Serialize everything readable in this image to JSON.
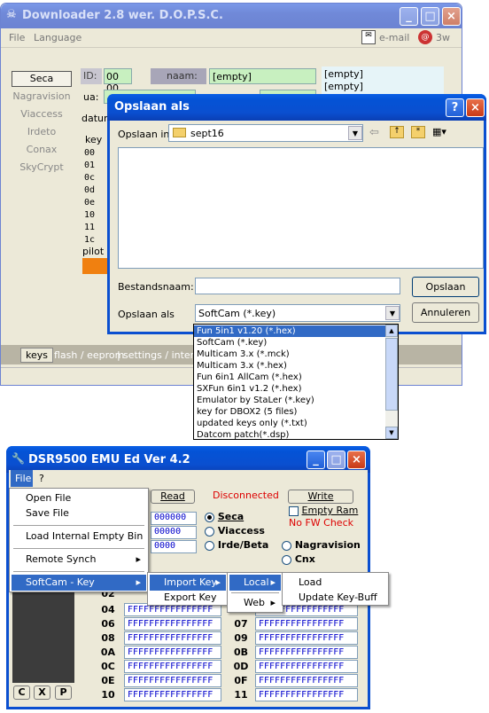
{
  "downloader": {
    "title": "Downloader 2.8 wer. D.O.P.S.C.",
    "menu": [
      "File",
      "Language"
    ],
    "email": "e-mail",
    "w3": "3w",
    "systems": [
      "Seca",
      "Nagravision",
      "Viaccess",
      "Irdeto",
      "Conax",
      "SkyCrypt"
    ],
    "id_label": "ID:",
    "id_value": "00 00",
    "naam_label": "naam:",
    "naam_value": "[empty]",
    "empty1": "[empty]",
    "empty2": "[empty]",
    "ua_label": "ua:",
    "datum_label": "datum",
    "key_label": "key",
    "keys": [
      "00",
      "01",
      "0c",
      "0d",
      "0e",
      "10",
      "11",
      "1c"
    ],
    "pilot_label": "pilot",
    "tabs": [
      "keys",
      "flash / eeprom",
      "settings / interne"
    ]
  },
  "save_dialog": {
    "title": "Opslaan als",
    "save_in_label": "Opslaan in:",
    "folder": "sept16",
    "filename_label": "Bestandsnaam:",
    "filename_value": "",
    "saveas_label": "Opslaan als",
    "type_value": "SoftCam (*.key)",
    "save_button": "Opslaan",
    "cancel_button": "Annuleren",
    "help": "?",
    "close": "×"
  },
  "type_list": [
    "Fun 5in1 v1.20 (*.hex)",
    "SoftCam (*.key)",
    "Multicam 3.x (*.mck)",
    "Multicam 3.x (*.hex)",
    "Fun 6in1 AllCam (*.hex)",
    "SXFun 6in1 v1.2 (*.hex)",
    "Emulator by StaLer (*.key)",
    "key for DBOX2 (5 files)",
    "updated keys only (*.txt)",
    "Datcom patch(*.dsp)"
  ],
  "dsr": {
    "title": "DSR9500 EMU Ed   Ver 4.2",
    "menu": [
      "File",
      "?"
    ],
    "read_button": "Read",
    "status": "Disconnected",
    "write_button": "Write",
    "empty_ram": "Empty Ram",
    "no_fw": "No FW Check",
    "systems_left": [
      "Seca",
      "Viaccess",
      "Irde/Beta"
    ],
    "systems_right": [
      "Nagravision",
      "Cnx"
    ],
    "top_fields": [
      "000000",
      "00000",
      "0000"
    ],
    "left_rows": [
      {
        "idx": "02",
        "val": "FFFFFFFFFFFFFFFF"
      },
      {
        "idx": "04",
        "val": "FFFFFFFFFFFFFFFF"
      },
      {
        "idx": "06",
        "val": "FFFFFFFFFFFFFFFF"
      },
      {
        "idx": "08",
        "val": "FFFFFFFFFFFFFFFF"
      },
      {
        "idx": "0A",
        "val": "FFFFFFFFFFFFFFFF"
      },
      {
        "idx": "0C",
        "val": "FFFFFFFFFFFFFFFF"
      },
      {
        "idx": "0E",
        "val": "FFFFFFFFFFFFFFFF"
      },
      {
        "idx": "10",
        "val": "FFFFFFFFFFFFFFFF"
      }
    ],
    "right_rows": [
      {
        "idx": "",
        "val": "FFFFFFFFFFFFFFFF"
      },
      {
        "idx": "07",
        "val": "FFFFFFFFFFFFFFFF"
      },
      {
        "idx": "09",
        "val": "FFFFFFFFFFFFFFFF"
      },
      {
        "idx": "0B",
        "val": "FFFFFFFFFFFFFFFF"
      },
      {
        "idx": "0D",
        "val": "FFFFFFFFFFFFFFFF"
      },
      {
        "idx": "0F",
        "val": "FFFFFFFFFFFFFFFF"
      },
      {
        "idx": "11",
        "val": "FFFFFFFFFFFFFFFF"
      }
    ],
    "bottom_buttons": [
      "C",
      "X",
      "P"
    ]
  },
  "file_menu": {
    "items": [
      "Open File",
      "Save File",
      "Load Internal Empty Bin",
      "Remote Synch",
      "SoftCam - Key"
    ],
    "submenu": [
      "Import Key",
      "Export Key"
    ],
    "submenu2": [
      "Local",
      "Web"
    ],
    "submenu3": [
      "Load",
      "Update Key-Buff"
    ]
  }
}
